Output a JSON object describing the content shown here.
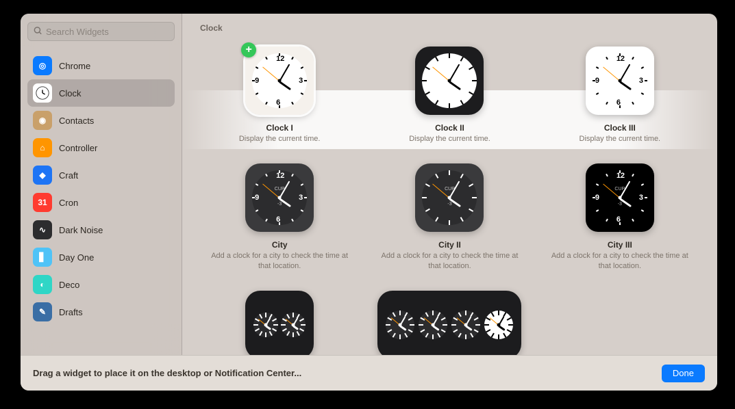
{
  "search": {
    "placeholder": "Search Widgets"
  },
  "sidebar": {
    "items": [
      {
        "label": "Chrome",
        "iconBg": "#0a7aff",
        "glyph": "◎"
      },
      {
        "label": "Clock",
        "iconBg": "#ffffff",
        "glyph": "clock",
        "selected": true
      },
      {
        "label": "Contacts",
        "iconBg": "#c9a06a",
        "glyph": "◉"
      },
      {
        "label": "Controller",
        "iconBg": "#ff9500",
        "glyph": "⌂"
      },
      {
        "label": "Craft",
        "iconBg": "#1d74f5",
        "glyph": "◆"
      },
      {
        "label": "Cron",
        "iconBg": "#ff3b30",
        "glyph": "31"
      },
      {
        "label": "Dark Noise",
        "iconBg": "#2c2c2e",
        "glyph": "∿"
      },
      {
        "label": "Day One",
        "iconBg": "#4fc3f7",
        "glyph": "▋"
      },
      {
        "label": "Deco",
        "iconBg": "#2fd6c6",
        "glyph": "◐"
      },
      {
        "label": "Drafts",
        "iconBg": "#3a6ea5",
        "glyph": "✎"
      }
    ]
  },
  "section": {
    "title": "Clock"
  },
  "widgets_row1": [
    {
      "title": "Clock I",
      "desc": "Display the current time.",
      "bg": "#f5f1ec",
      "face": "#ffffff",
      "faceFg": "#000000",
      "square": false,
      "numbers": true,
      "selected": true,
      "add": true
    },
    {
      "title": "Clock II",
      "desc": "Display the current time.",
      "bg": "#1c1c1e",
      "face": "#ffffff",
      "faceFg": "#000000",
      "square": false,
      "numbers": false,
      "selected": false
    },
    {
      "title": "Clock III",
      "desc": "Display the current time.",
      "bg": "#ffffff",
      "face": "#ffffff",
      "faceFg": "#000000",
      "square": true,
      "numbers": true,
      "selected": false
    }
  ],
  "widgets_row2": [
    {
      "title": "City",
      "desc": "Add a clock for a city to check the time at that location.",
      "bg": "#3a3a3c",
      "face": "#2c2c2e",
      "faceFg": "#ffffff",
      "square": false,
      "numbers": true,
      "city": "CUP"
    },
    {
      "title": "City II",
      "desc": "Add a clock for a city to check the time at that location.",
      "bg": "#3a3a3c",
      "face": "#2c2c2e",
      "faceFg": "#ffffff",
      "square": false,
      "numbers": false,
      "city": "CUP"
    },
    {
      "title": "City III",
      "desc": "Add a clock for a city to check the time at that location.",
      "bg": "#000000",
      "face": "#000000",
      "faceFg": "#ffffff",
      "square": true,
      "numbers": true,
      "city": "CUP"
    }
  ],
  "widgets_row3": {
    "small": {
      "bg": "#1c1c1e",
      "clocks": 2
    },
    "wide": {
      "bg": "#1c1c1e",
      "clocks": 4,
      "lastWhite": true
    }
  },
  "time": {
    "hourAngle": 125,
    "minuteAngle": 30,
    "secondAngle": -50
  },
  "footer": {
    "hint": "Drag a widget to place it on the desktop or Notification Center...",
    "done": "Done"
  }
}
